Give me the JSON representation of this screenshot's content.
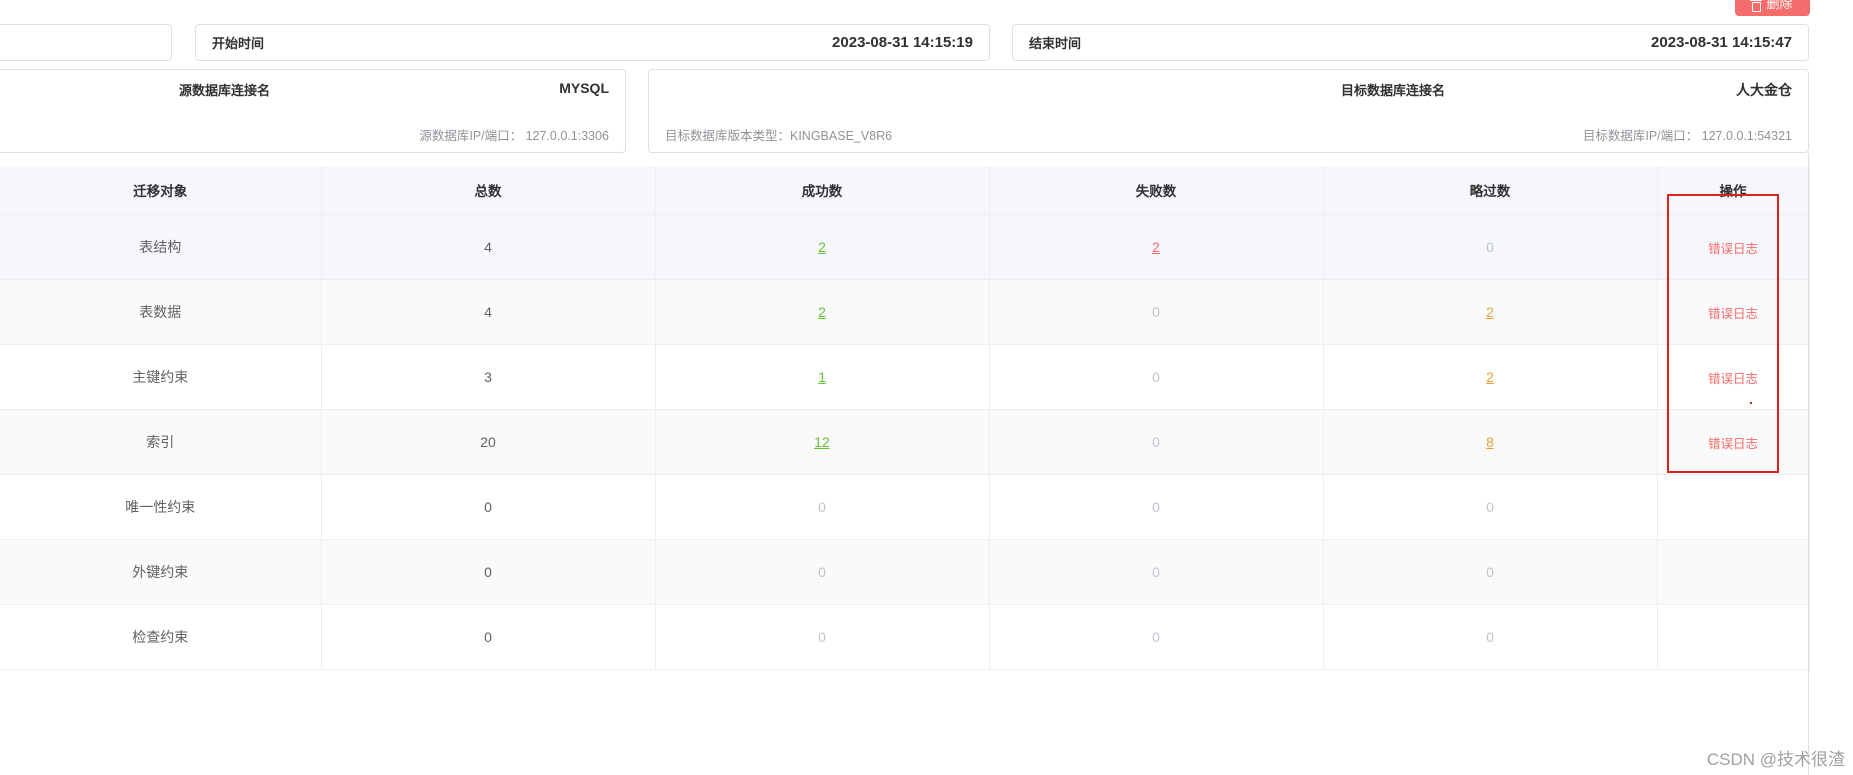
{
  "toolbar": {
    "delete_label": "删除"
  },
  "time": {
    "start_label": "开始时间",
    "start_value": "2023-08-31 14:15:19",
    "end_label": "结束时间",
    "end_value": "2023-08-31 14:15:47"
  },
  "source": {
    "name_label": "源数据库连接名",
    "db_type": "MYSQL",
    "ip_text": "源数据库IP/端口：  127.0.0.1:3306"
  },
  "target": {
    "name_label": "目标数据库连接名",
    "db_type": "人大金仓",
    "version_text": "目标数据库版本类型：KINGBASE_V8R6",
    "ip_text": "目标数据库IP/端口：  127.0.0.1:54321"
  },
  "table": {
    "headers": [
      "迁移对象",
      "总数",
      "成功数",
      "失败数",
      "略过数",
      "操作"
    ],
    "rows": [
      {
        "object": "表结构",
        "total": "4",
        "success": "2",
        "failed": "2",
        "skipped": "0",
        "action": "错误日志"
      },
      {
        "object": "表数据",
        "total": "4",
        "success": "2",
        "failed": "0",
        "skipped": "2",
        "action": "错误日志"
      },
      {
        "object": "主键约束",
        "total": "3",
        "success": "1",
        "failed": "0",
        "skipped": "2",
        "action": "错误日志"
      },
      {
        "object": "索引",
        "total": "20",
        "success": "12",
        "failed": "0",
        "skipped": "8",
        "action": "错误日志"
      },
      {
        "object": "唯一性约束",
        "total": "0",
        "success": "0",
        "failed": "0",
        "skipped": "0",
        "action": ""
      },
      {
        "object": "外键约束",
        "total": "0",
        "success": "0",
        "failed": "0",
        "skipped": "0",
        "action": ""
      },
      {
        "object": "检查约束",
        "total": "0",
        "success": "0",
        "failed": "0",
        "skipped": "0",
        "action": ""
      }
    ]
  },
  "colors": {
    "success": "#67c23a",
    "failed": "#f56c6c",
    "skipped": "#e6a23c",
    "zero": "#c0c4cc",
    "highlight": "#e02020"
  },
  "watermark": "CSDN @技术很渣"
}
